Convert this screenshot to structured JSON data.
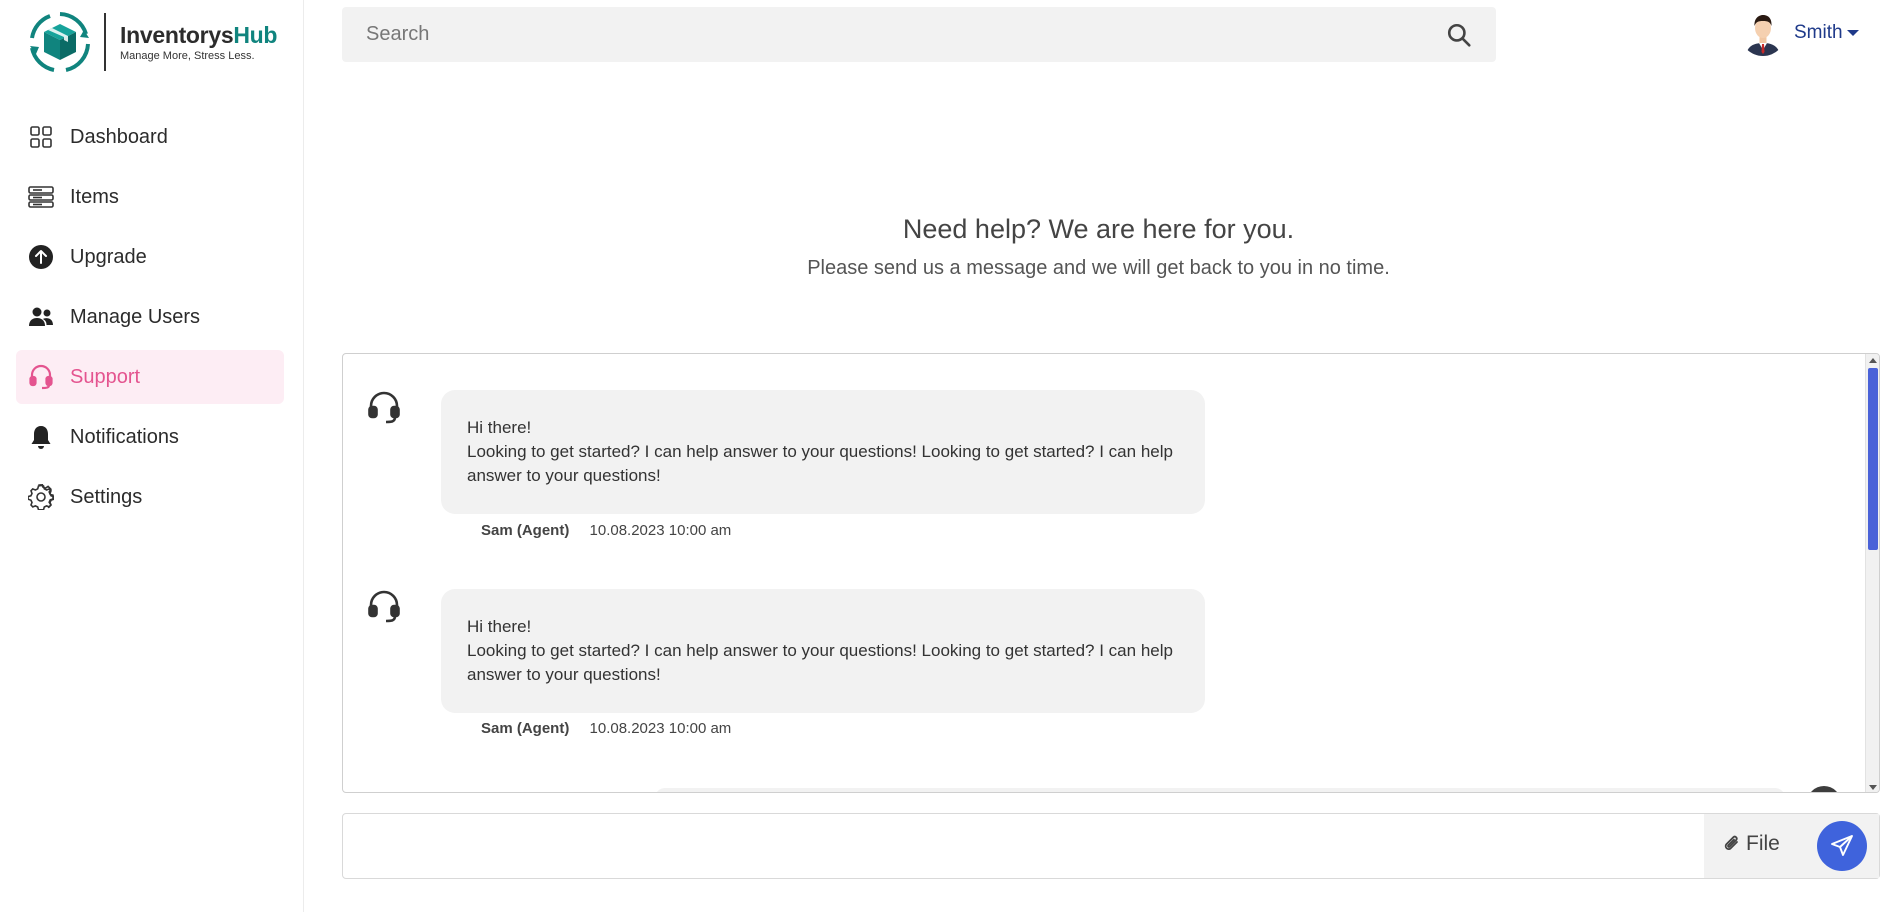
{
  "brand": {
    "name_part1": "Inventorys",
    "name_part2": "Hub",
    "tagline": "Manage More, Stress Less.",
    "accent_color": "#10847e"
  },
  "sidebar": {
    "items": [
      {
        "label": "Dashboard",
        "icon": "grid-icon",
        "active": false
      },
      {
        "label": "Items",
        "icon": "server-stack-icon",
        "active": false
      },
      {
        "label": "Upgrade",
        "icon": "arrow-up-circle-icon",
        "active": false
      },
      {
        "label": "Manage Users",
        "icon": "users-icon",
        "active": false
      },
      {
        "label": "Support",
        "icon": "headset-icon",
        "active": true
      },
      {
        "label": "Notifications",
        "icon": "bell-icon",
        "active": false
      },
      {
        "label": "Settings",
        "icon": "gear-icon",
        "active": false
      }
    ],
    "active_color": "#e4548f",
    "active_bg": "#fdedf4"
  },
  "search": {
    "placeholder": "Search",
    "value": ""
  },
  "user": {
    "name": "Smith"
  },
  "hero": {
    "title": "Need help? We are here for you.",
    "subtitle": "Please send us a message and we will get back to you in no time."
  },
  "messages": [
    {
      "greeting": "Hi there!",
      "body": "Looking to get started? I can help answer to your questions! Looking to get started? I can help answer to your questions!",
      "sender": "Sam  (Agent)",
      "time": "10.08.2023 10:00 am"
    },
    {
      "greeting": "Hi there!",
      "body": "Looking to get started? I can help answer to your questions! Looking to get started? I can help answer to your questions!",
      "sender": "Sam  (Agent)",
      "time": "10.08.2023 10:00 am"
    }
  ],
  "composer": {
    "value": "",
    "file_label": "File",
    "send_color": "#3f63dc"
  }
}
